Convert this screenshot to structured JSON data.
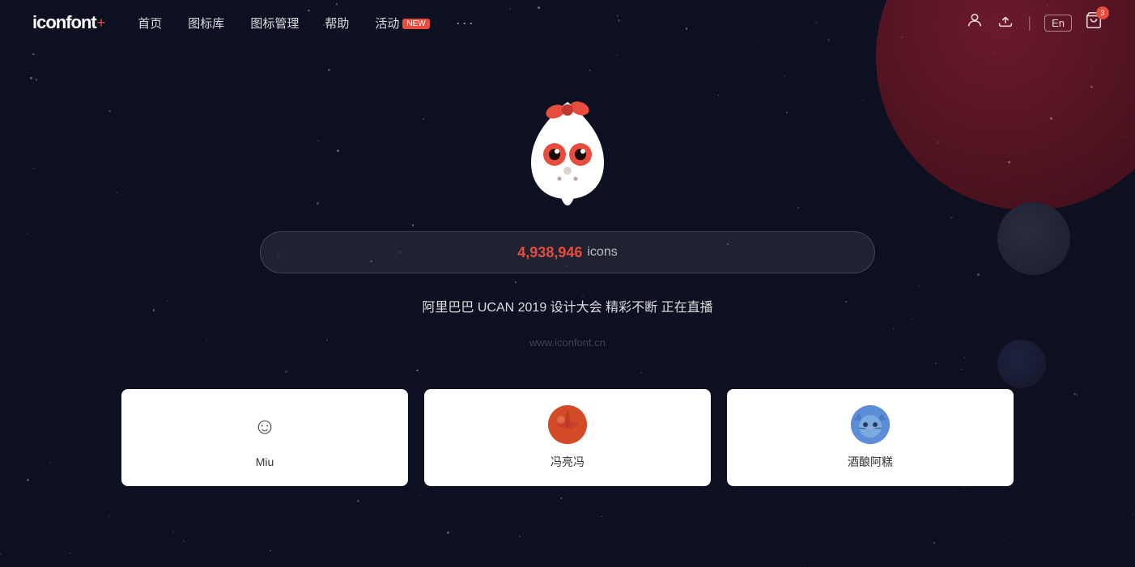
{
  "logo": {
    "text": "iconfont",
    "plus": "+"
  },
  "nav": {
    "items": [
      {
        "label": "首页",
        "id": "home"
      },
      {
        "label": "图标库",
        "id": "library"
      },
      {
        "label": "图标管理",
        "id": "manage"
      },
      {
        "label": "帮助",
        "id": "help"
      },
      {
        "label": "活动",
        "id": "activity",
        "badge": "NEW"
      },
      {
        "label": "···",
        "id": "more"
      }
    ]
  },
  "header": {
    "lang_btn": "En",
    "cart_count": "3"
  },
  "hero": {
    "icon_count": "4,938,946",
    "icon_label": "icons",
    "banner_text": "阿里巴巴 UCAN 2019 设计大会 精彩不断 正在直播",
    "url_watermark": "www.iconfont.cn"
  },
  "cards": [
    {
      "id": "miu",
      "name": "Miu",
      "has_avatar": false
    },
    {
      "id": "fengliangfeng",
      "name": "冯亮冯",
      "has_avatar": true,
      "avatar_type": "orange"
    },
    {
      "id": "jiujiu",
      "name": "酒酿阿糕",
      "has_avatar": true,
      "avatar_type": "blue"
    }
  ]
}
